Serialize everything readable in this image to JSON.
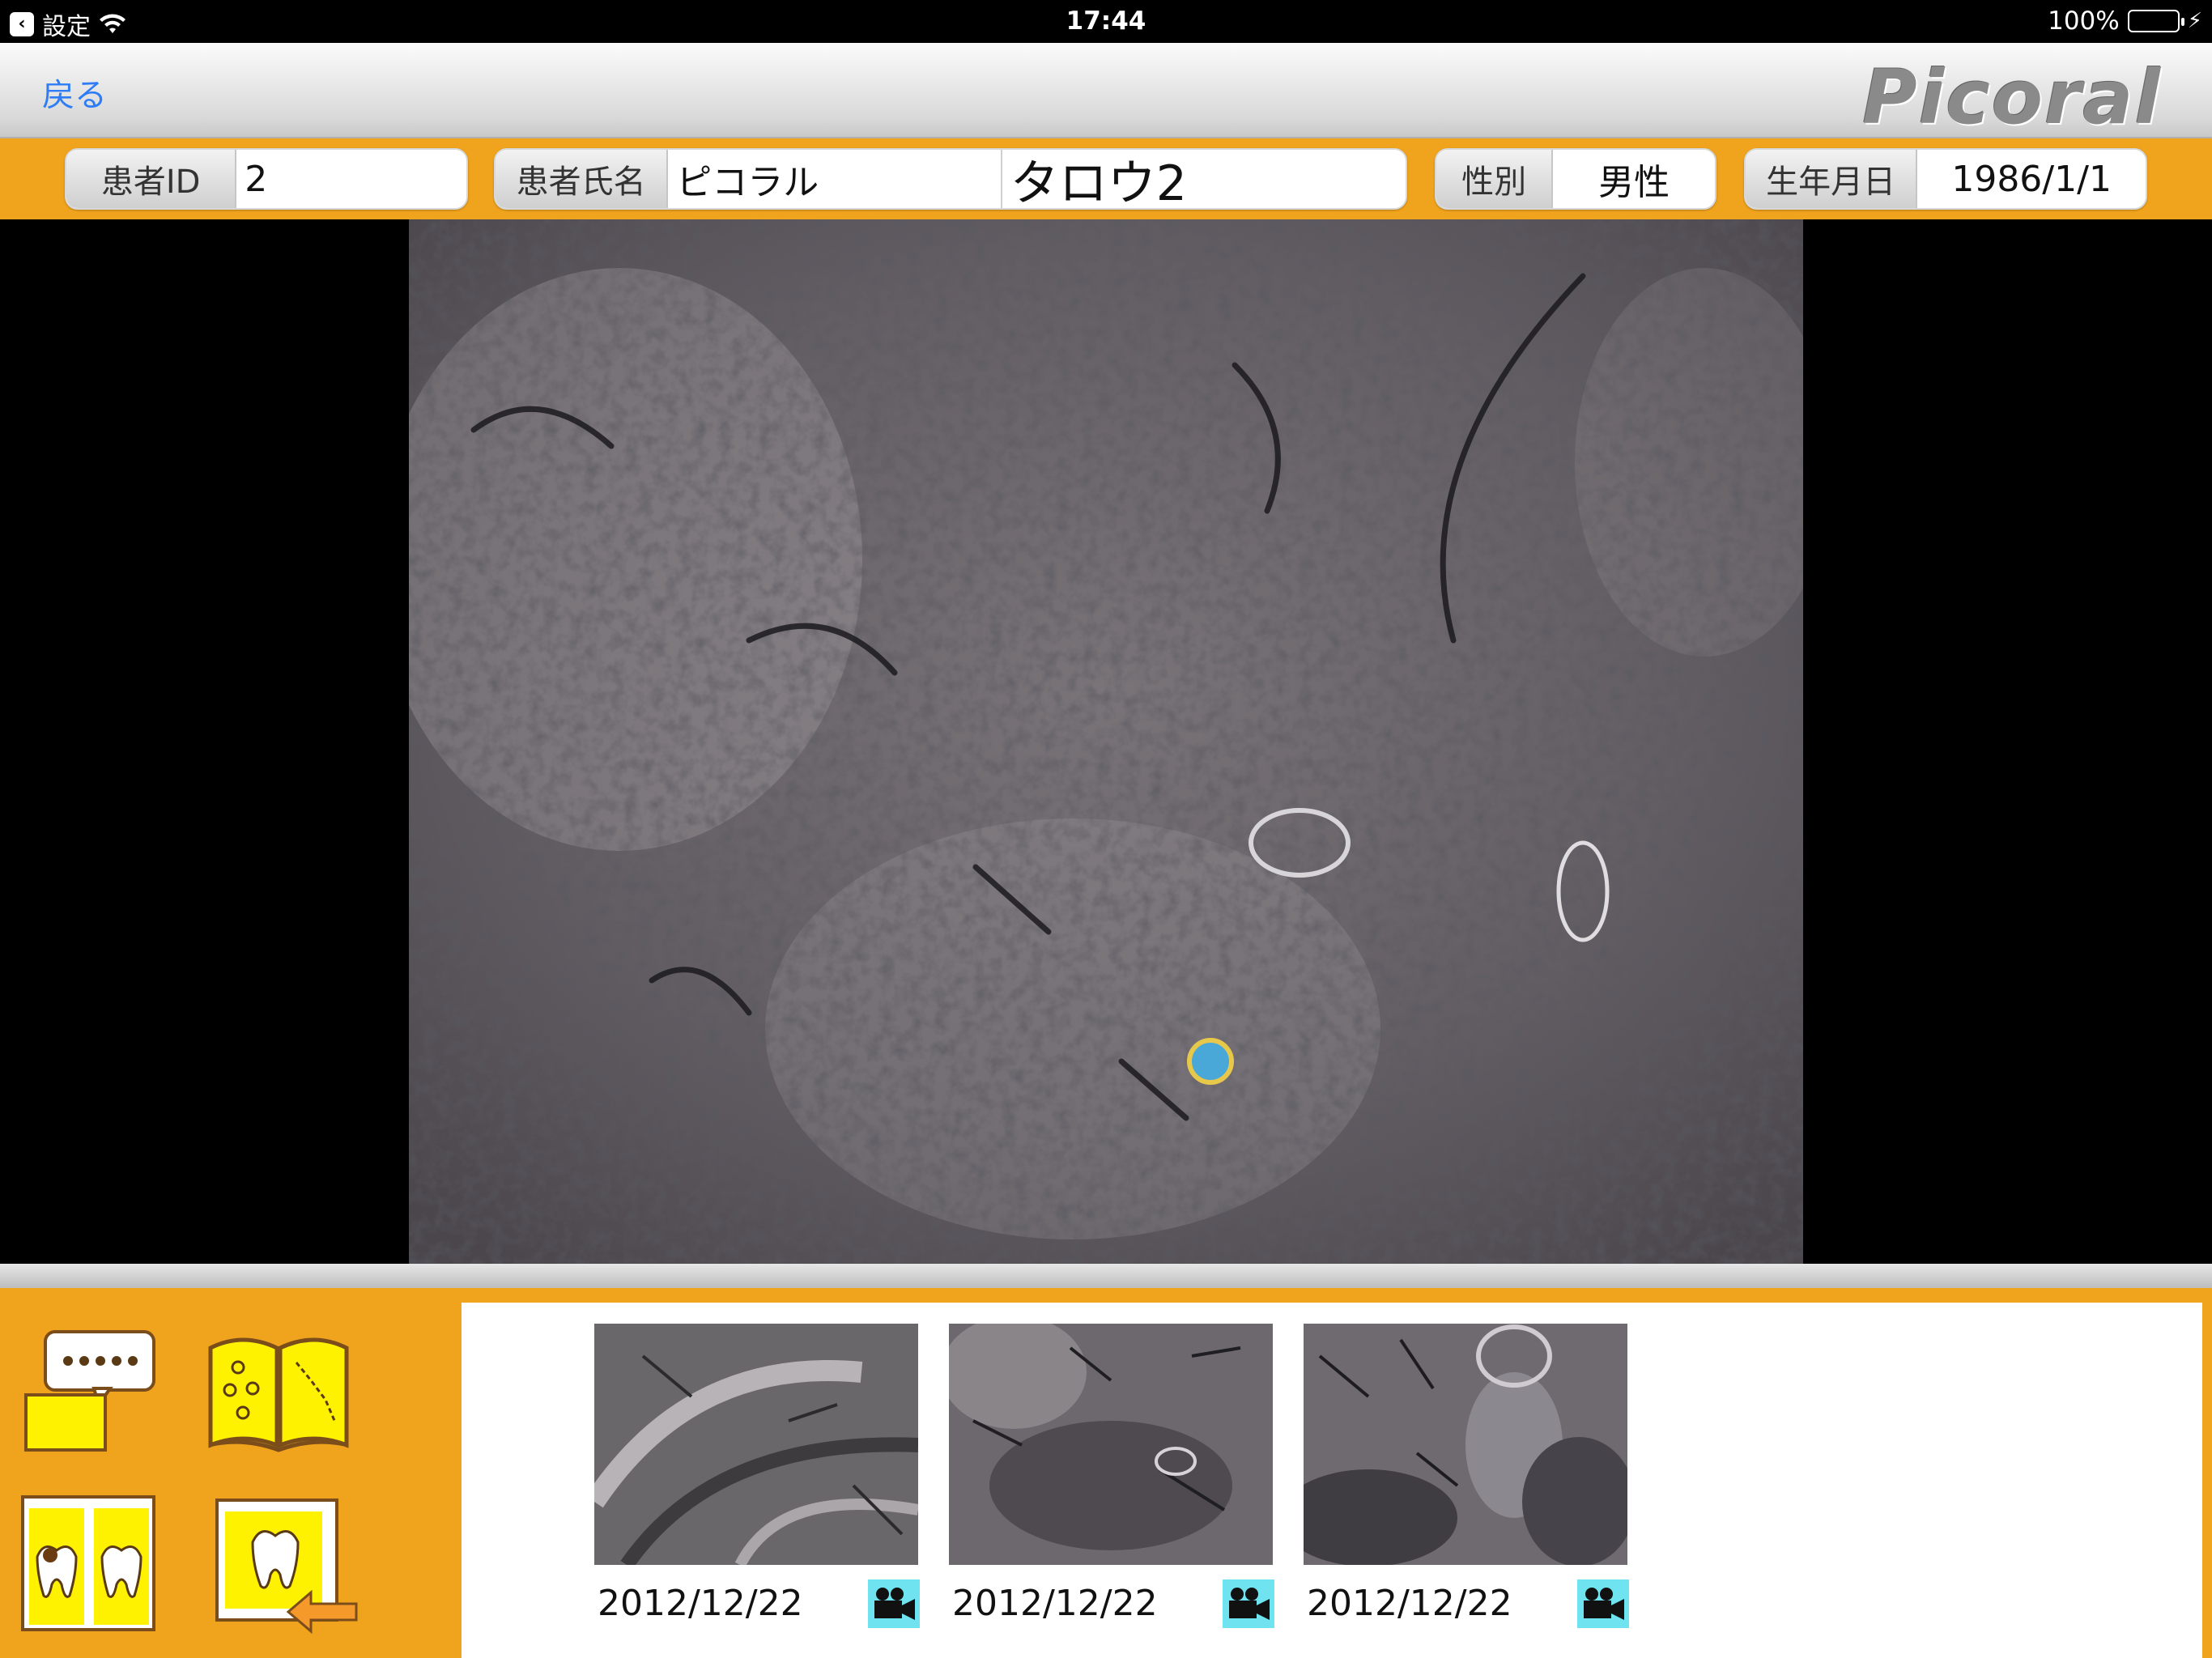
{
  "status_bar": {
    "back_app": "設定",
    "time": "17:44",
    "battery": "100%"
  },
  "nav": {
    "back_label": "戻る",
    "logo": "Picoral"
  },
  "patient": {
    "id_label": "患者ID",
    "id_value": "2",
    "name_label": "患者氏名",
    "name_last": "ピコラル",
    "name_first": "タロウ2",
    "sex_label": "性別",
    "sex_value": "男性",
    "dob_label": "生年月日",
    "dob_value": "1986/1/1"
  },
  "videos": [
    {
      "date": "2012/12/22",
      "icon": "video-camera-icon"
    },
    {
      "date": "2012/12/22",
      "icon": "video-camera-icon"
    },
    {
      "date": "2012/12/22",
      "icon": "video-camera-icon"
    }
  ],
  "tools": [
    {
      "icon": "comment-icon"
    },
    {
      "icon": "bacteria-book-icon"
    },
    {
      "icon": "tooth-compare-icon"
    },
    {
      "icon": "tooth-import-icon"
    }
  ],
  "colors": {
    "accent": "#f0a31c",
    "link": "#2f7df6",
    "camera_bg": "#6fe3f0",
    "tool_yellow": "#fff200"
  }
}
